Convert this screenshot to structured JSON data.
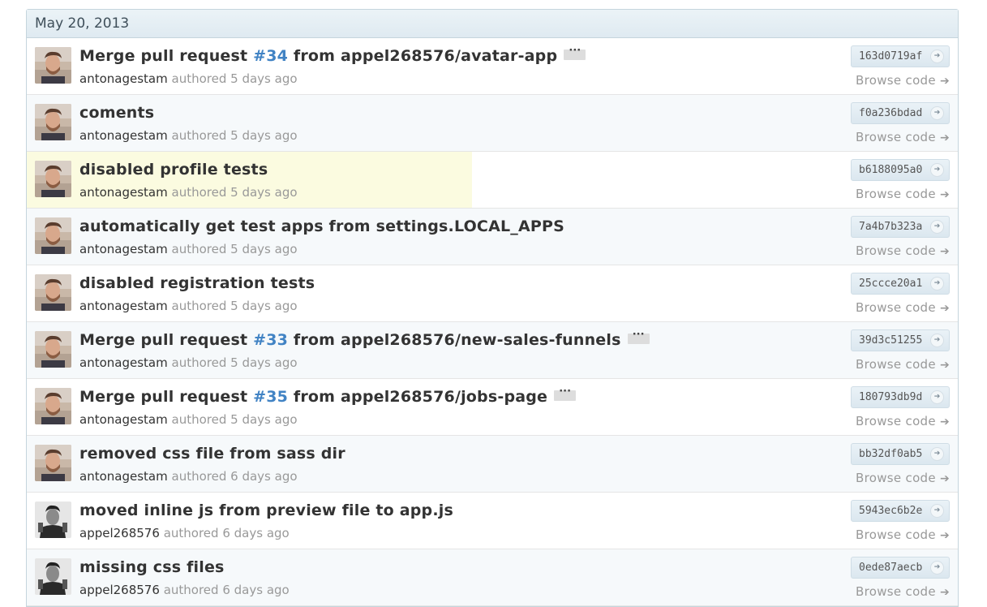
{
  "group": {
    "date": "May 20, 2013",
    "commits": [
      {
        "msg_prefix": "Merge pull request ",
        "pr": "#34",
        "msg_suffix": " from appel268576/avatar-app",
        "expander": "···",
        "author": "antonagestam",
        "verb": "authored",
        "when": "5 days ago",
        "sha": "163d0719af",
        "avatar": "avatar-antonagestam",
        "highlight": false
      },
      {
        "msg_prefix": "coments",
        "pr": "",
        "msg_suffix": "",
        "expander": "",
        "author": "antonagestam",
        "verb": "authored",
        "when": "5 days ago",
        "sha": "f0a236bdad",
        "avatar": "avatar-antonagestam",
        "highlight": false
      },
      {
        "msg_prefix": "disabled profile tests",
        "pr": "",
        "msg_suffix": "",
        "expander": "",
        "author": "antonagestam",
        "verb": "authored",
        "when": "5 days ago",
        "sha": "b6188095a0",
        "avatar": "avatar-antonagestam",
        "highlight": true
      },
      {
        "msg_prefix": "automatically get test apps from settings.LOCAL_APPS",
        "pr": "",
        "msg_suffix": "",
        "expander": "",
        "author": "antonagestam",
        "verb": "authored",
        "when": "5 days ago",
        "sha": "7a4b7b323a",
        "avatar": "avatar-antonagestam",
        "highlight": false
      },
      {
        "msg_prefix": "disabled registration tests",
        "pr": "",
        "msg_suffix": "",
        "expander": "",
        "author": "antonagestam",
        "verb": "authored",
        "when": "5 days ago",
        "sha": "25ccce20a1",
        "avatar": "avatar-antonagestam",
        "highlight": false
      },
      {
        "msg_prefix": "Merge pull request ",
        "pr": "#33",
        "msg_suffix": " from appel268576/new-sales-funnels",
        "expander": "···",
        "author": "antonagestam",
        "verb": "authored",
        "when": "5 days ago",
        "sha": "39d3c51255",
        "avatar": "avatar-antonagestam",
        "highlight": false
      },
      {
        "msg_prefix": "Merge pull request ",
        "pr": "#35",
        "msg_suffix": " from appel268576/jobs-page",
        "expander": "···",
        "author": "antonagestam",
        "verb": "authored",
        "when": "5 days ago",
        "sha": "180793db9d",
        "avatar": "avatar-antonagestam",
        "highlight": false
      },
      {
        "msg_prefix": "removed css file from sass dir",
        "pr": "",
        "msg_suffix": "",
        "expander": "",
        "author": "antonagestam",
        "verb": "authored",
        "when": "6 days ago",
        "sha": "bb32df0ab5",
        "avatar": "avatar-antonagestam",
        "highlight": false
      },
      {
        "msg_prefix": "moved inline js from preview file to app.js",
        "pr": "",
        "msg_suffix": "",
        "expander": "",
        "author": "appel268576",
        "verb": "authored",
        "when": "6 days ago",
        "sha": "5943ec6b2e",
        "avatar": "avatar-appel268576",
        "highlight": false
      },
      {
        "msg_prefix": "missing css files",
        "pr": "",
        "msg_suffix": "",
        "expander": "",
        "author": "appel268576",
        "verb": "authored",
        "when": "6 days ago",
        "sha": "0ede87aecb",
        "avatar": "avatar-appel268576",
        "highlight": false
      }
    ]
  },
  "labels": {
    "browse_code": "Browse code",
    "browse_arrow_icon": "arrow-right-icon",
    "sha_arrow_icon": "arrow-circle-icon"
  },
  "colors": {
    "link": "#4183c4",
    "highlight": "#fbfbe0",
    "header_bg": "#e5eff5"
  }
}
